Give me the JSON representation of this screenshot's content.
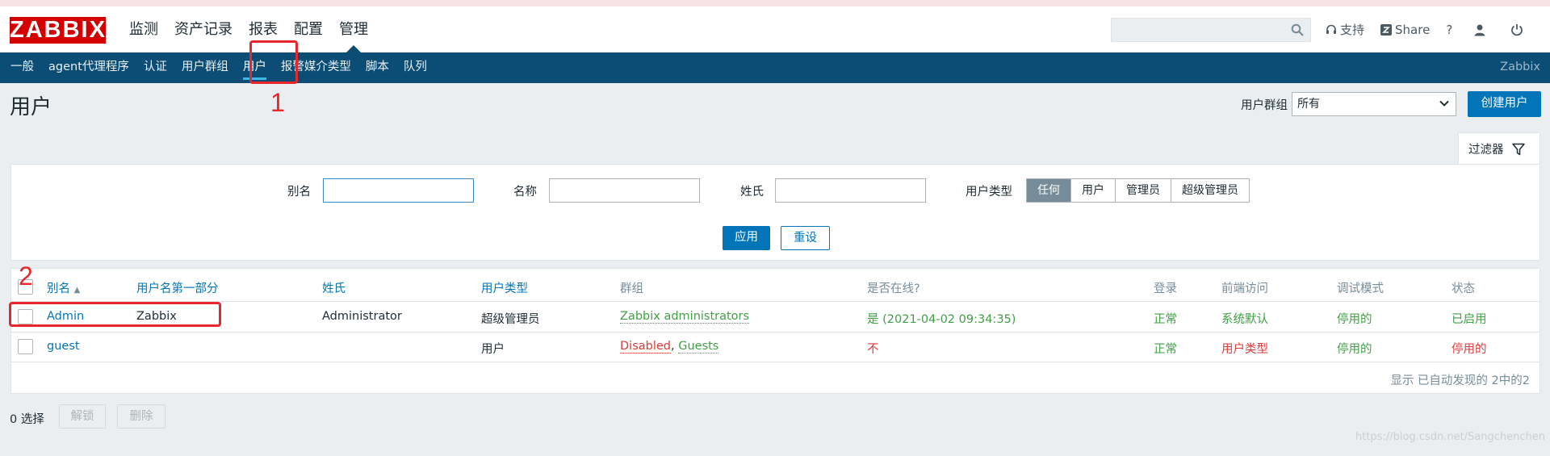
{
  "header": {
    "logo": "ZABBIX",
    "main_menu": [
      "监测",
      "资产记录",
      "报表",
      "配置",
      "管理"
    ],
    "active_main": "管理",
    "search_placeholder": "",
    "support": "支持",
    "share": "Share",
    "help": "?"
  },
  "subnav": {
    "items": [
      "一般",
      "agent代理程序",
      "认证",
      "用户群组",
      "用户",
      "报警媒介类型",
      "脚本",
      "队列"
    ],
    "active": "用户",
    "brand": "Zabbix"
  },
  "page": {
    "title": "用户",
    "usergroup_label": "用户群组",
    "usergroup_value": "所有",
    "create_button": "创建用户"
  },
  "filter": {
    "tab_label": "过滤器",
    "alias_label": "别名",
    "alias_value": "",
    "name_label": "名称",
    "name_value": "",
    "surname_label": "姓氏",
    "surname_value": "",
    "type_label": "用户类型",
    "type_options": [
      "任何",
      "用户",
      "管理员",
      "超级管理员"
    ],
    "type_selected": "任何",
    "apply": "应用",
    "reset": "重设"
  },
  "table": {
    "headers": [
      "别名",
      "用户名第一部分",
      "姓氏",
      "用户类型",
      "群组",
      "是否在线?",
      "登录",
      "前端访问",
      "调试模式",
      "状态"
    ],
    "sort_indicator": "▲",
    "rows": [
      {
        "alias": "Admin",
        "name": "Zabbix",
        "surname": "Administrator",
        "type": "超级管理员",
        "groups": [
          "Zabbix administrators"
        ],
        "online": "是 (2021-04-02 09:34:35)",
        "login": "正常",
        "frontend": "系统默认",
        "debug": "停用的",
        "status": "已启用"
      },
      {
        "alias": "guest",
        "name": "",
        "surname": "",
        "type": "用户",
        "groups": [
          "Disabled",
          "Guests"
        ],
        "group_separator": ", ",
        "online": "不",
        "login": "正常",
        "frontend": "用户类型",
        "debug": "停用的",
        "status": "停用的"
      }
    ],
    "found_text": "显示 已自动发现的 2中的2"
  },
  "footer": {
    "selected": "0 选择",
    "unblock": "解锁",
    "delete": "删除"
  },
  "annotations": [
    "1",
    "2"
  ],
  "watermark": "https://blog.csdn.net/Sangchenchen",
  "colors": {
    "brand_red": "#d40000",
    "nav_blue": "#0b4d75",
    "link_blue": "#0275b8",
    "green": "#429e47",
    "red": "#dc3a3a",
    "annotation_red": "#e8262c"
  }
}
